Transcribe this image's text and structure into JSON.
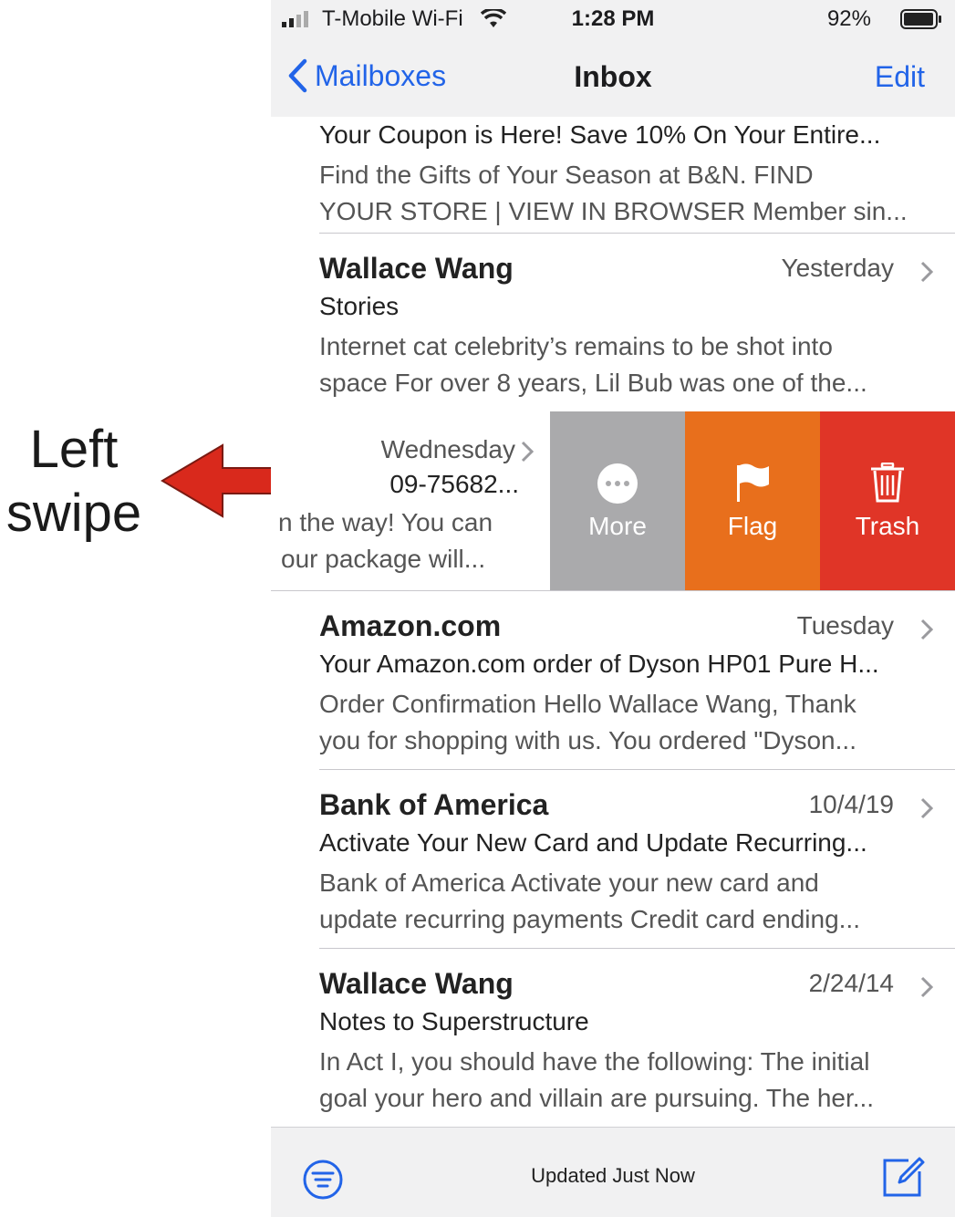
{
  "annotation": {
    "line1": "Left",
    "line2": "swipe"
  },
  "status_bar": {
    "carrier": "T-Mobile Wi-Fi",
    "time": "1:28 PM",
    "battery": "92%"
  },
  "nav": {
    "back_label": "Mailboxes",
    "title": "Inbox",
    "edit_label": "Edit"
  },
  "messages_top": {
    "subject": "Your Coupon is Here! Save 10% On Your Entire...",
    "preview1": "Find the Gifts of Your Season at B&N. FIND",
    "preview2": "YOUR STORE | VIEW IN BROWSER Member sin..."
  },
  "message_1": {
    "sender": "Wallace Wang",
    "date": "Yesterday",
    "subject": "Stories",
    "preview1": "Internet cat celebrity’s remains to be shot into",
    "preview2": "space For over 8 years, Lil Bub was one of the..."
  },
  "swiped_message": {
    "date": "Wednesday",
    "line2": "09-75682...",
    "line3": "n the way! You can",
    "line4": "our package will..."
  },
  "swipe_actions": {
    "more": "More",
    "flag": "Flag",
    "trash": "Trash"
  },
  "message_2": {
    "sender": "Amazon.com",
    "date": "Tuesday",
    "subject": "Your Amazon.com order of Dyson HP01 Pure H...",
    "preview1": "Order Confirmation Hello Wallace Wang, Thank",
    "preview2": "you for shopping with us. You ordered \"Dyson..."
  },
  "message_3": {
    "sender": "Bank of America",
    "date": "10/4/19",
    "subject": "Activate Your New Card and Update Recurring...",
    "preview1": "Bank of America Activate your new card and",
    "preview2": "update recurring payments Credit card ending..."
  },
  "message_4": {
    "sender": "Wallace Wang",
    "date": "2/24/14",
    "subject": "Notes to Superstructure",
    "preview1": "In Act I, you should have the following: The initial",
    "preview2": "goal your hero and villain are pursuing. The her..."
  },
  "toolbar": {
    "status": "Updated Just Now"
  },
  "colors": {
    "accent": "#2264e8",
    "more": "#aaaaac",
    "flag": "#e86f1c",
    "trash": "#e03527",
    "arrow": "#d9291c"
  }
}
